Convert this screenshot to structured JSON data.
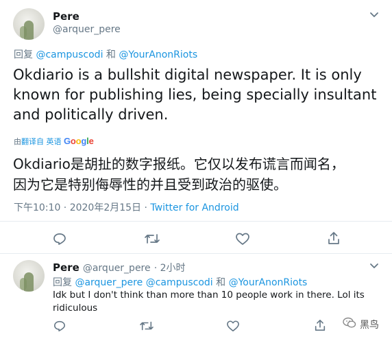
{
  "main_tweet": {
    "author_name": "Pere",
    "author_handle": "@arquer_pere",
    "reply_prefix": "回复",
    "reply_to_1": "@campuscodi",
    "reply_join": "和",
    "reply_to_2": "@YourAnonRiots",
    "text_line1": "Okdiario is a bullshit digital newspaper. It is only",
    "text_line2": "known for publishing lies, being specially insultant",
    "text_line3": "and politically driven.",
    "translate_by": "由",
    "translate_label": "翻译自 英语",
    "translate_engine": "Google",
    "translation_line1": "Okdiario是胡扯的数字报纸。它仅以发布谎言而闻名，",
    "translation_line2": "因为它是特别侮辱性的并且受到政治的驱使。",
    "time_date": "下午10:10 · 2020年2月15日 · ",
    "source": "Twitter for Android"
  },
  "reply_tweet": {
    "author_name": "Pere",
    "author_handle": "@arquer_pere",
    "time": "· 2小时",
    "reply_prefix": "回复",
    "reply_to_1": "@arquer_pere",
    "reply_to_2": "@campuscodi",
    "reply_join": "和",
    "reply_to_3": "@YourAnonRiots",
    "text_line1": "Idk but I don't think than more than 10 people work in there. Lol its",
    "text_line2": "ridiculous"
  },
  "watermark": "黑鸟",
  "colors": {
    "link": "#1b95e0",
    "muted": "#657786",
    "text": "#14171a",
    "divider": "#e6ecf0"
  },
  "icons": [
    "chevron-down-icon",
    "reply-icon",
    "retweet-icon",
    "like-icon",
    "share-icon",
    "wechat-icon"
  ]
}
